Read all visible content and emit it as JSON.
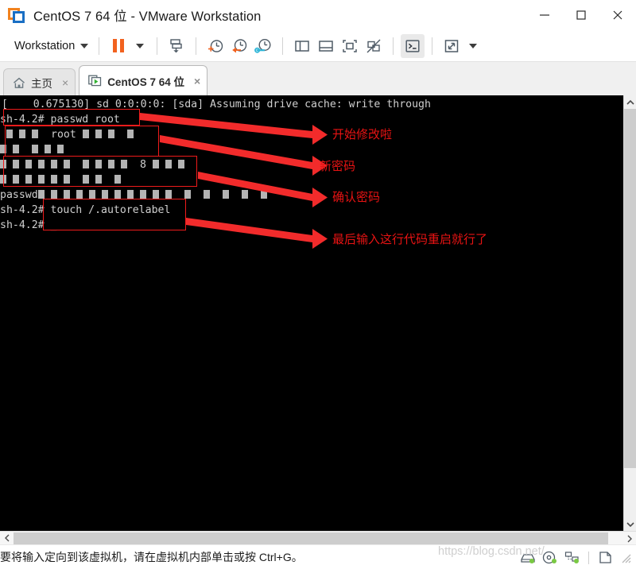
{
  "window": {
    "title": "CentOS 7 64 位 - VMware Workstation",
    "app_icon": "vmware-logo-icon",
    "controls": {
      "minimize": "minimize-icon",
      "maximize": "maximize-icon",
      "close": "close-icon"
    }
  },
  "toolbar": {
    "menu_label": "Workstation",
    "items": [
      {
        "name": "pause-vm-button",
        "icon": "pause-icon"
      },
      {
        "name": "pause-dropdown-button",
        "icon": "chevron-down-icon"
      },
      {
        "name": "install-tools-button",
        "icon": "install-vmware-tools-icon"
      },
      {
        "name": "take-snapshot-button",
        "icon": "snapshot-add-icon"
      },
      {
        "name": "revert-snapshot-button",
        "icon": "snapshot-revert-icon"
      },
      {
        "name": "manage-snapshots-button",
        "icon": "snapshot-manager-icon"
      },
      {
        "name": "show-library-button",
        "icon": "panel-left-icon"
      },
      {
        "name": "show-thumbnails-button",
        "icon": "panel-bottom-icon"
      },
      {
        "name": "full-screen-button",
        "icon": "fullscreen-icon"
      },
      {
        "name": "unity-mode-button",
        "icon": "unity-disabled-icon"
      },
      {
        "name": "console-view-button",
        "icon": "console-prompt-icon"
      },
      {
        "name": "stretch-view-button",
        "icon": "stretch-arrows-icon"
      },
      {
        "name": "stretch-dropdown-button",
        "icon": "chevron-down-icon"
      }
    ]
  },
  "tabs": [
    {
      "label": "主页",
      "icon": "home-icon",
      "close": "×",
      "selected": false
    },
    {
      "label": "CentOS 7 64 位",
      "icon": "vm-power-icon",
      "close": "×",
      "selected": true
    }
  ],
  "terminal": {
    "lines": [
      {
        "text": "[    0.675130] sd 0:0:0:0: [sda] Assuming drive cache: write through"
      },
      {
        "text": "sh-4.2# passwd root"
      },
      {
        "text": "          root"
      },
      {
        "text": ""
      },
      {
        "text": "                         8"
      },
      {
        "text": ""
      },
      {
        "text": "passwd"
      },
      {
        "text": "sh-4.2# touch /.autorelabel"
      },
      {
        "text": "sh-4.2# _"
      }
    ],
    "commands": {
      "passwd_root": "passwd root",
      "touch_autorelabel": "touch /.autorelabel",
      "prompt": "sh-4.2#"
    }
  },
  "annotations": [
    {
      "text": "开始修改啦",
      "name": "annotation-start-editing"
    },
    {
      "text": "新密码",
      "name": "annotation-new-password"
    },
    {
      "text": "确认密码",
      "name": "annotation-confirm-password"
    },
    {
      "text": "最后输入这行代码重启就行了",
      "name": "annotation-final-reboot"
    }
  ],
  "statusbar": {
    "message": "要将输入定向到该虚拟机，请在虚拟机内部单击或按 Ctrl+G。",
    "icons": [
      {
        "name": "hard-disk-status-icon"
      },
      {
        "name": "cd-dvd-status-icon"
      },
      {
        "name": "network-status-icon"
      },
      {
        "name": "usb-status-icon"
      }
    ]
  },
  "watermark": "https://blog.csdn.net/",
  "colors": {
    "accent_orange": "#f2621f",
    "accent_blue": "#1a6fc4",
    "annotation_red": "#e81313",
    "terminal_bg": "#000000",
    "terminal_fg": "#cfcfcf"
  }
}
